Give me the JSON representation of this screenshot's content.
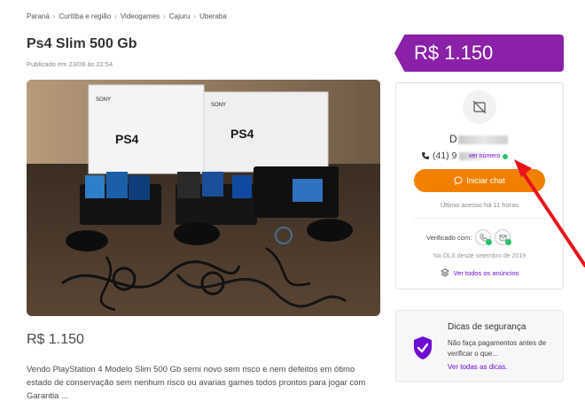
{
  "breadcrumb": [
    "Paraná",
    "Curitiba e região",
    "Videogames",
    "Cajuru",
    "Uberaba"
  ],
  "ad": {
    "title": "Ps4 Slim 500 Gb",
    "published": "Publicado em 23/09 às 22:54",
    "price": "R$ 1.150",
    "description": "Vendo PlayStation 4 Modelo Slim 500 Gb semi novo sem risco e nem defeitos em ótimo estado de conservação sem nenhum risco ou avarias games todos prontos para jogar com Garantia ..."
  },
  "photo": {
    "box_brand": "SONY",
    "box_label": "PS4"
  },
  "seller": {
    "name_initial": "D",
    "phone_prefix": "(41) 9",
    "view_number": "ver número",
    "chat_button": "Iniciar chat",
    "last_access": "Último acesso há 11 horas",
    "verified_label": "Verificado com:",
    "member_since": "Na OLX desde setembro de 2019",
    "all_ads": "Ver todos os anúncios"
  },
  "safety": {
    "title": "Dicas de segurança",
    "text": "Não faça pagamentos antes de verificar o que...",
    "link": "Ver todas as dicas."
  },
  "colors": {
    "brand_purple": "#8a21a8",
    "link_purple": "#6d0ad6",
    "cta_orange": "#f28000",
    "verified_green": "#26c36a",
    "annotation_red": "#e8141c"
  }
}
